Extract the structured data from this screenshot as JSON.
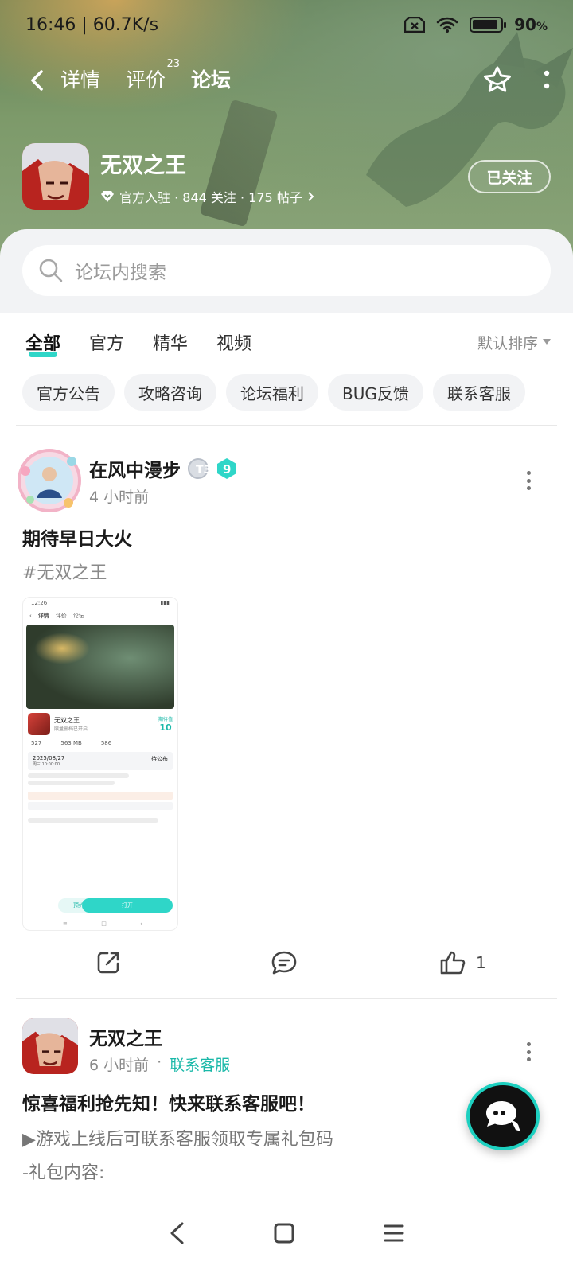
{
  "status_bar": {
    "time_speed": "16:46 | 60.7K/s",
    "battery": "90",
    "battery_unit": "%",
    "battery_level": 0.9
  },
  "nav": {
    "tabs": [
      {
        "label": "详情",
        "badge": ""
      },
      {
        "label": "评价",
        "badge": "23"
      },
      {
        "label": "论坛",
        "badge": ""
      }
    ],
    "active_tab": "论坛"
  },
  "game": {
    "name": "无双之王",
    "stats": "官方入驻 · 844 关注 · 175 帖子",
    "follow_label": "已关注"
  },
  "search": {
    "placeholder": "论坛内搜索"
  },
  "filters": {
    "tabs": [
      "全部",
      "官方",
      "精华",
      "视频"
    ],
    "sort_label": "默认排序"
  },
  "chips": [
    "官方公告",
    "攻略咨询",
    "论坛福利",
    "BUG反馈",
    "联系客服"
  ],
  "posts": [
    {
      "author": "在风中漫步",
      "level_badge": "T3",
      "rank_badge": "9",
      "time": "4 小时前",
      "title": "期待早日大火",
      "tag": "#无双之王",
      "like_count": "1",
      "screenshot": {
        "time": "12:26",
        "nav_tabs": [
          "详情",
          "评价",
          "论坛"
        ],
        "game_name": "无双之王",
        "game_sub": "限量删档已开启",
        "score_label": "期待值",
        "score": "10",
        "stats": [
          "527",
          "563 MB",
          "586"
        ],
        "test_date": "2025/08/27",
        "test_time": "周三 10:00:00",
        "test_status": "待公布",
        "btn_reserve": "预约",
        "btn_open": "打开"
      }
    },
    {
      "author": "无双之王",
      "time": "6 小时前",
      "category": "联系客服",
      "title": "惊喜福利抢先知！快来联系客服吧！",
      "body": [
        "▶游戏上线后可联系客服领取专属礼包码",
        "-礼包内容:"
      ]
    }
  ]
}
